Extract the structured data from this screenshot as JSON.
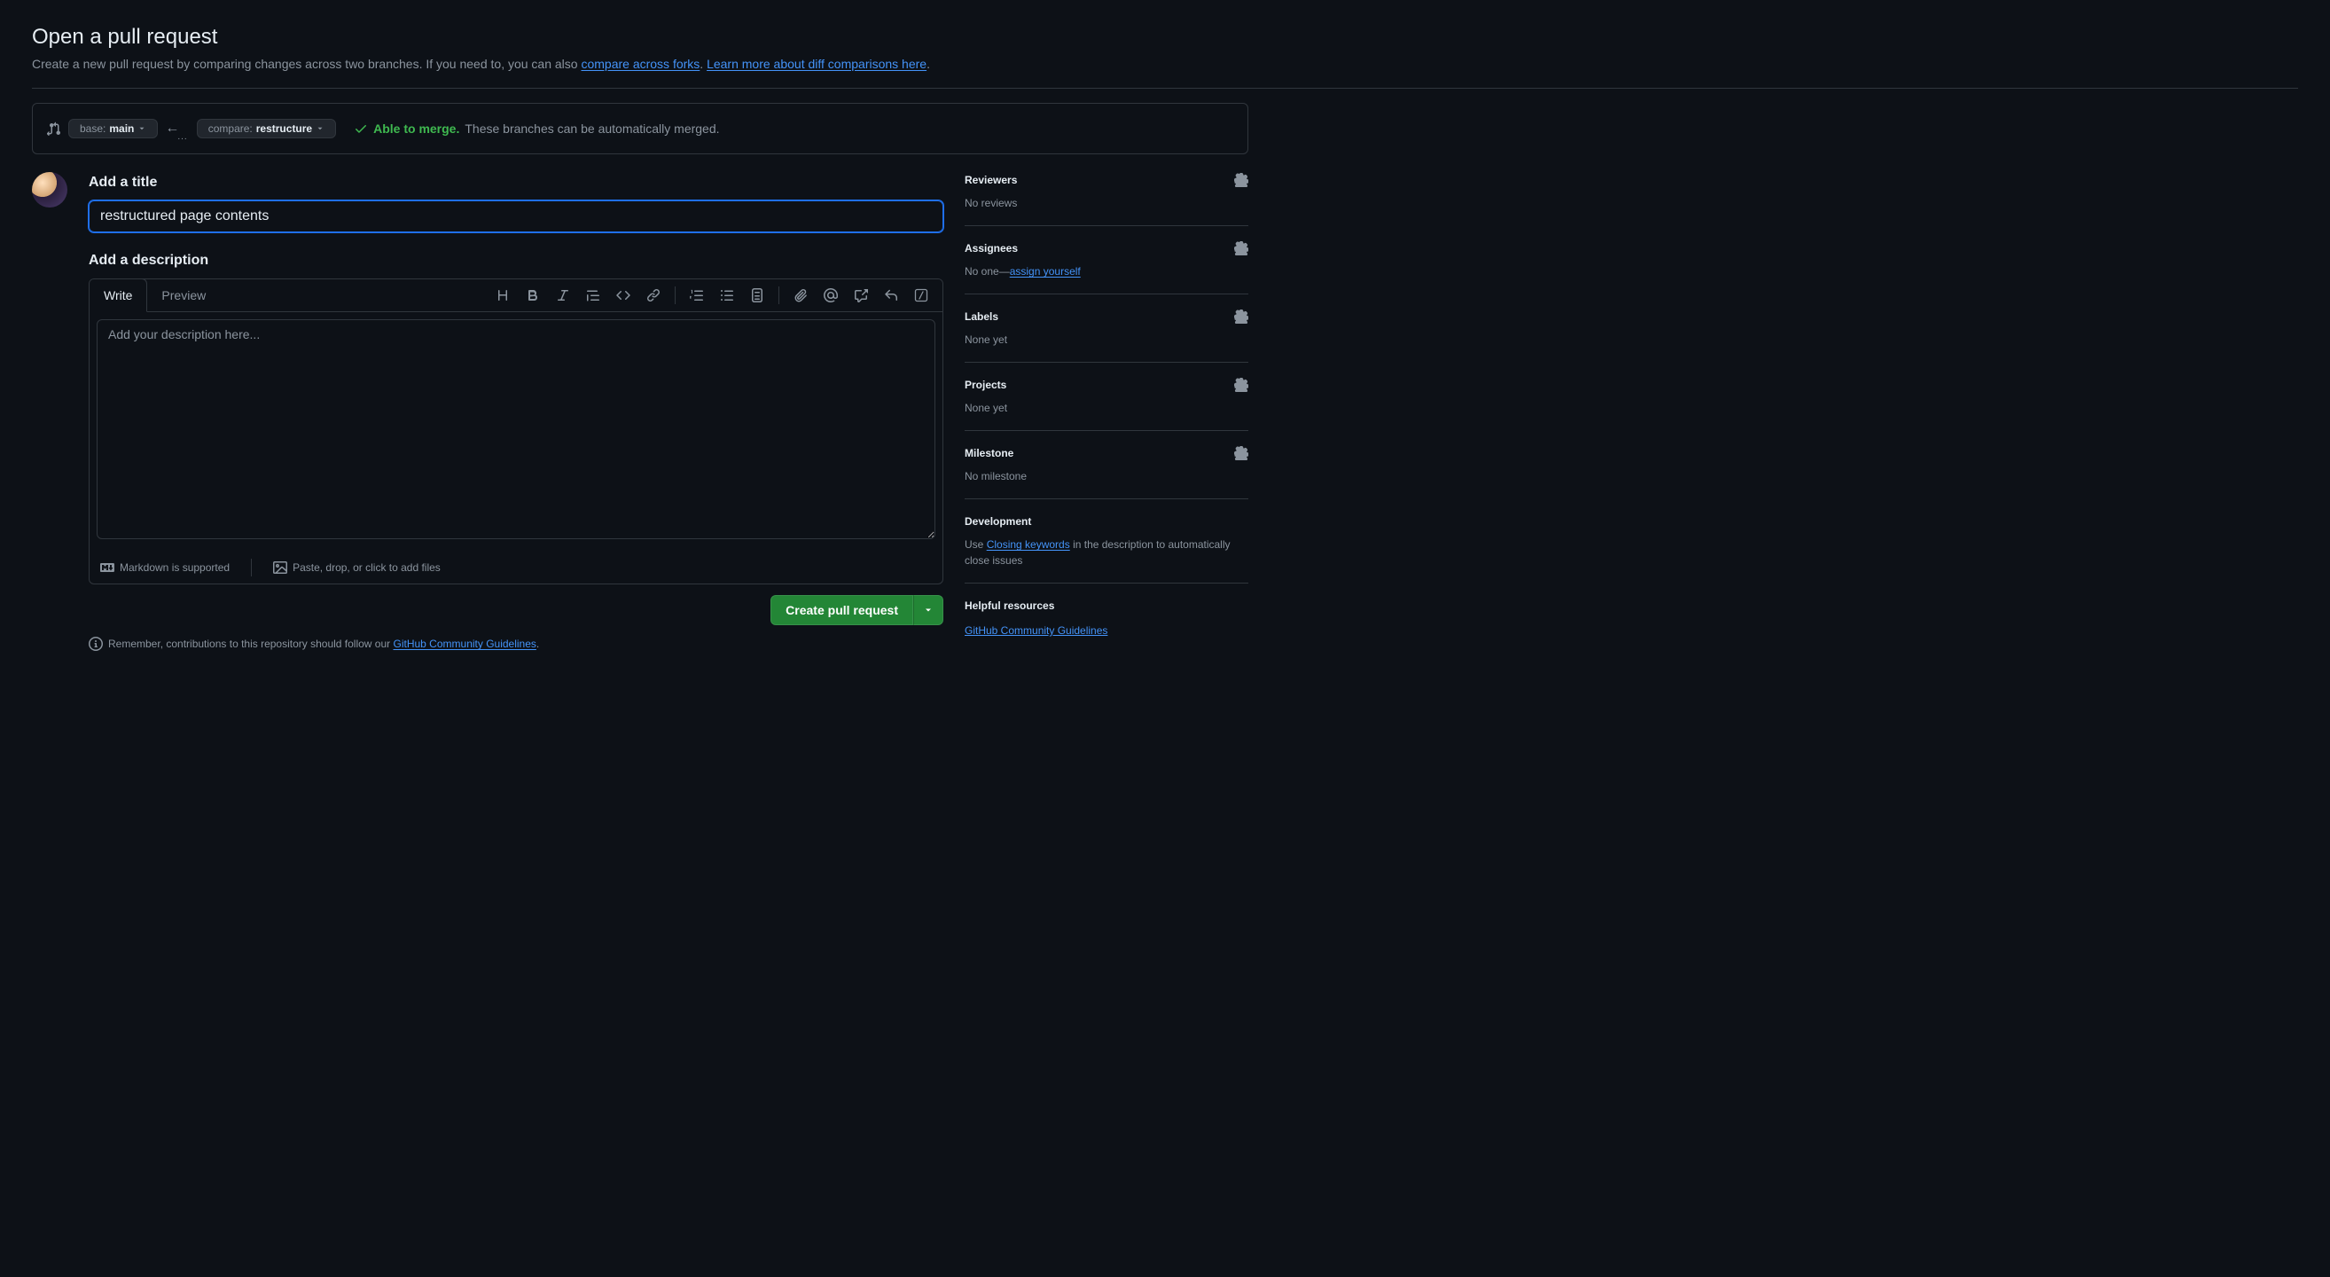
{
  "header": {
    "title": "Open a pull request",
    "subtitle_prefix": "Create a new pull request by comparing changes across two branches. If you need to, you can also ",
    "compare_link": "compare across forks",
    "subtitle_mid": ". ",
    "learn_link": "Learn more about diff comparisons here",
    "subtitle_suffix": "."
  },
  "branch": {
    "base_label": "base: ",
    "base_value": "main",
    "compare_label": "compare: ",
    "compare_value": "restructure",
    "able_text": "Able to merge.",
    "rest_text": " These branches can be automatically merged."
  },
  "form": {
    "title_label": "Add a title",
    "title_value": "restructured page contents",
    "desc_label": "Add a description",
    "tabs": {
      "write": "Write",
      "preview": "Preview"
    },
    "placeholder": "Add your description here...",
    "markdown_text": "Markdown is supported",
    "paste_text": "Paste, drop, or click to add files",
    "create_button": "Create pull request",
    "remember_prefix": "Remember, contributions to this repository should follow our ",
    "remember_link": "GitHub Community Guidelines",
    "remember_suffix": "."
  },
  "sidebar": {
    "reviewers": {
      "title": "Reviewers",
      "body": "No reviews"
    },
    "assignees": {
      "title": "Assignees",
      "body_prefix": "No one—",
      "assign_link": "assign yourself"
    },
    "labels": {
      "title": "Labels",
      "body": "None yet"
    },
    "projects": {
      "title": "Projects",
      "body": "None yet"
    },
    "milestone": {
      "title": "Milestone",
      "body": "No milestone"
    },
    "development": {
      "title": "Development",
      "use": "Use ",
      "closing_link": "Closing keywords",
      "rest": " in the description to automatically close issues"
    },
    "resources": {
      "title": "Helpful resources",
      "link": "GitHub Community Guidelines"
    }
  }
}
